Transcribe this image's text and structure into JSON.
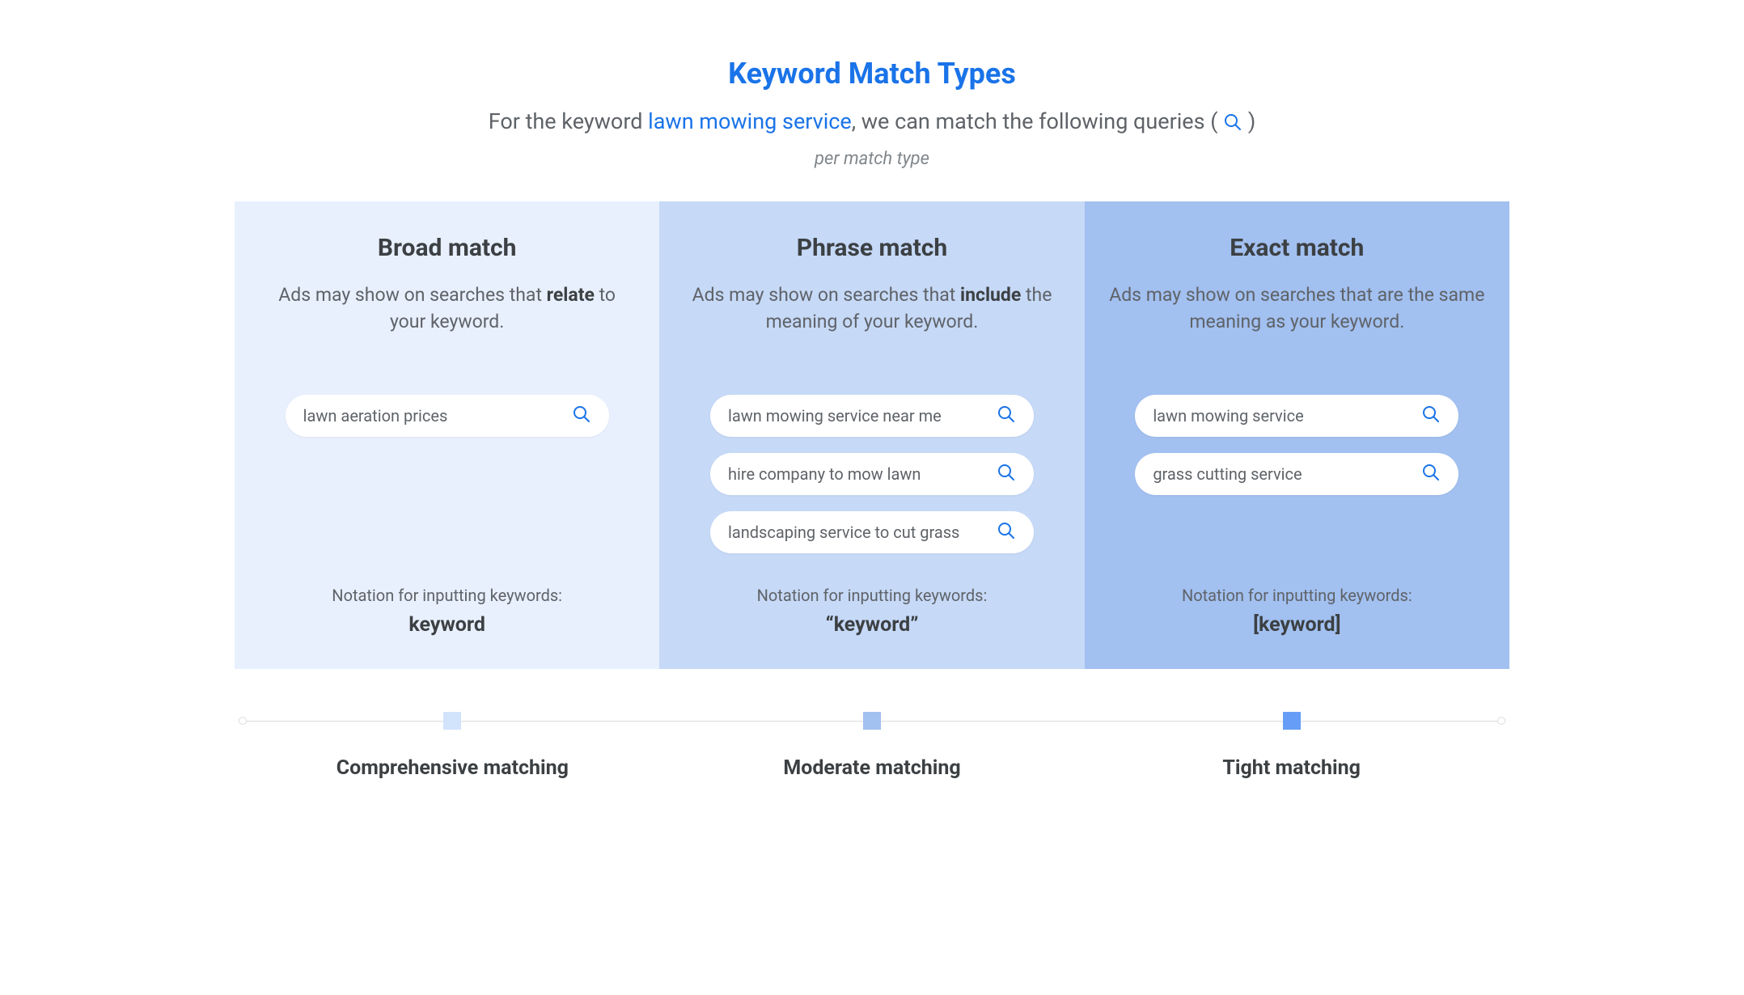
{
  "title": "Keyword Match Types",
  "subtitle_prefix": "For the keyword ",
  "subtitle_keyword": "lawn mowing service",
  "subtitle_suffix": ", we can match the following queries ( ",
  "subtitle_close": " )",
  "per_type": "per match type",
  "columns": {
    "broad": {
      "title": "Broad match",
      "desc_pre": "Ads may show on searches that ",
      "desc_bold": "relate",
      "desc_post": " to your keyword.",
      "queries": [
        "lawn aeration prices"
      ],
      "notation_label": "Notation for inputting keywords:",
      "notation_value": "keyword"
    },
    "phrase": {
      "title": "Phrase match",
      "desc_pre": "Ads may show on searches that ",
      "desc_bold": "include",
      "desc_post": " the meaning of your keyword.",
      "queries": [
        "lawn mowing service near me",
        "hire company to mow lawn",
        "landscaping service to cut grass"
      ],
      "notation_label": "Notation for inputting keywords:",
      "notation_value": "“keyword”"
    },
    "exact": {
      "title": "Exact match",
      "desc_pre": "Ads may show on searches that are the same meaning as your keyword.",
      "desc_bold": "",
      "desc_post": "",
      "queries": [
        "lawn mowing service",
        "grass cutting service"
      ],
      "notation_label": "Notation for inputting keywords:",
      "notation_value": "[keyword]"
    }
  },
  "scale": {
    "labels": [
      "Comprehensive matching",
      "Moderate matching",
      "Tight matching"
    ]
  },
  "colors": {
    "accent": "#1a73e8"
  }
}
